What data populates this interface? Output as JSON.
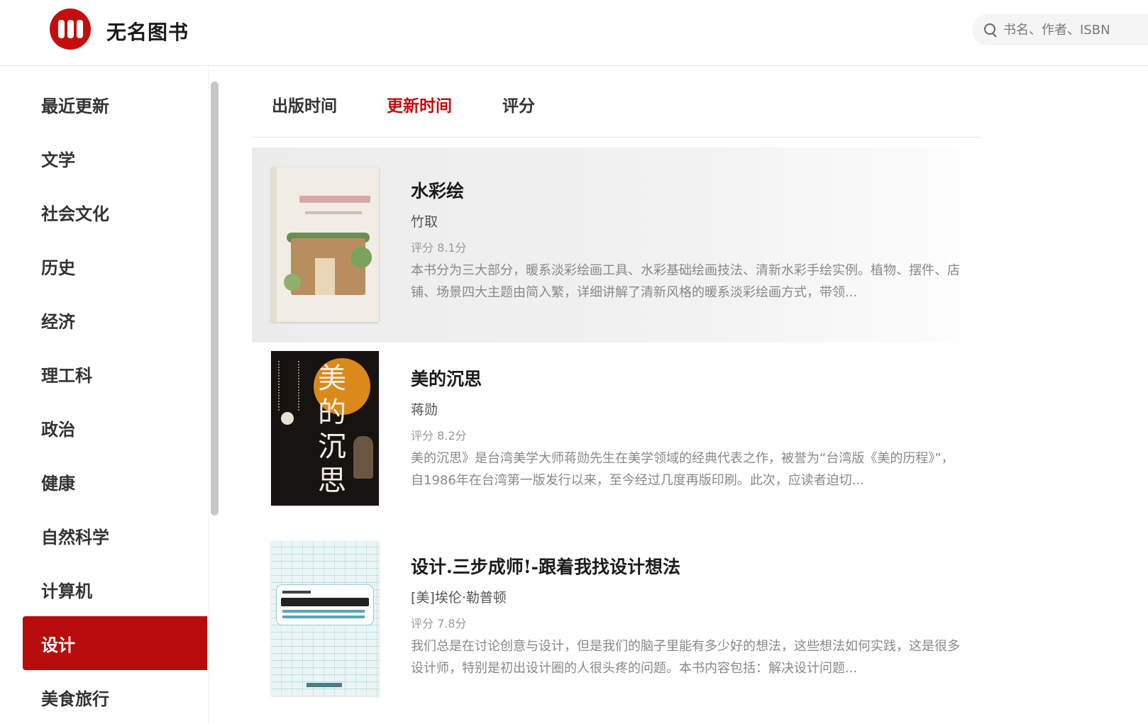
{
  "header": {
    "brand": "无名图书",
    "search_placeholder": "书名、作者、ISBN"
  },
  "sidebar": {
    "items": [
      {
        "label": "最近更新"
      },
      {
        "label": "文学"
      },
      {
        "label": "社会文化"
      },
      {
        "label": "历史"
      },
      {
        "label": "经济"
      },
      {
        "label": "理工科"
      },
      {
        "label": "政治"
      },
      {
        "label": "健康"
      },
      {
        "label": "自然科学"
      },
      {
        "label": "计算机"
      },
      {
        "label": "设计"
      },
      {
        "label": "美食旅行"
      }
    ],
    "active": "设计"
  },
  "tabs": [
    {
      "label": "出版时间"
    },
    {
      "label": "更新时间"
    },
    {
      "label": "评分"
    }
  ],
  "active_tab": "更新时间",
  "books": [
    {
      "title": "水彩绘",
      "author": "竹取",
      "rating": "评分 8.1分",
      "description": "本书分为三大部分，暖系淡彩绘画工具、水彩基础绘画技法、清新水彩手绘实例。植物、摆件、店铺、场景四大主题由简入繁，详细讲解了清新风格的暖系淡彩绘画方式，带领..."
    },
    {
      "title": "美的沉思",
      "author": "蒋勋",
      "rating": "评分 8.2分",
      "description": "美的沉思》是台湾美学大师蒋勋先生在美学领域的经典代表之作，被誉为“台湾版《美的历程》”，自1986年在台湾第一版发行以来，至今经过几度再版印刷。此次，应读者迫切...",
      "cover_chars": [
        "美",
        "的",
        "沉",
        "思"
      ]
    },
    {
      "title": "设计.三步成师!-跟着我找设计想法",
      "author": "[美]埃伦·勒普顿",
      "rating": "评分 7.8分",
      "description": "我们总是在讨论创意与设计，但是我们的脑子里能有多少好的想法，这些想法如何实践，这是很多设计师，特别是初出设计圈的人很头疼的问题。本书内容包括：解决设计问题..."
    }
  ],
  "colors": {
    "accent": "#c40d0d",
    "active_bg": "#b80c0c"
  }
}
